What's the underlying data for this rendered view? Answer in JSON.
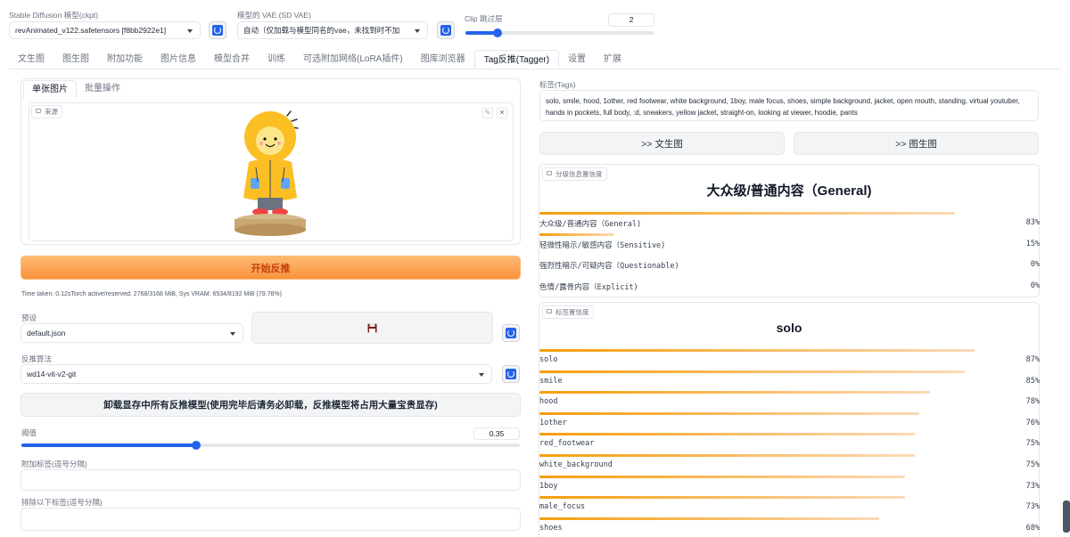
{
  "header": {
    "model_label": "Stable Diffusion 模型(ckpt)",
    "model_value": "revAnimated_v122.safetensors [f8bb2922e1]",
    "vae_label": "模型的 VAE (SD VAE)",
    "vae_value": "自动（仅加载与模型同名的vae，未找到时不加",
    "clip_label": "Clip 跳过层",
    "clip_value": "2",
    "clip_fraction": 0.17
  },
  "tabs": [
    "文生图",
    "图生图",
    "附加功能",
    "图片信息",
    "模型合并",
    "训练",
    "可选附加网络(LoRA插件)",
    "图库浏览器",
    "Tag反推(Tagger)",
    "设置",
    "扩展"
  ],
  "active_tab": "Tag反推(Tagger)",
  "left": {
    "subtabs": [
      "单张图片",
      "批量操作"
    ],
    "source_label": "来源",
    "interrogate_button": "开始反推",
    "time_info": "Time taken: 0.12sTorch active/reserved: 2768/3168 MiB, Sys VRAM: 6534/8192 MiB (79.76%)",
    "preset_label": "预设",
    "preset_value": "default.json",
    "save_icon": "floppy-disk-icon",
    "interrogator_label": "反推算法",
    "interrogator_value": "wd14-vit-v2-git",
    "unload_button": "卸载显存中所有反推模型(使用完毕后请务必卸载，反推模型将占用大量宝贵显存)",
    "threshold_label": "阈值",
    "threshold_value": "0.35",
    "threshold_fraction": 0.35,
    "additional_tags_label": "附加标签(逗号分隔)",
    "exclude_tags_label": "排除以下标签(逗号分隔)"
  },
  "right": {
    "tags_label": "标签(Tags)",
    "tags_text": "solo, smile, hood, 1other, red footwear, white background, 1boy, male focus, shoes, simple background, jacket, open mouth, standing, virtual youtuber, hands in pockets, full body, :d, sneakers, yellow jacket, straight-on, looking at viewer, hoodie, pants",
    "to_txt2img": ">> 文生图",
    "to_img2img": ">> 图生图",
    "rating_tag": "分级信息置信度",
    "rating_title": "大众级/普通内容（General)",
    "ratings": [
      {
        "label": "大众级/普通内容（General)",
        "pct": "83%",
        "value": 0.83
      },
      {
        "label": "轻微性暗示/敏感内容（Sensitive)",
        "pct": "15%",
        "value": 0.15
      },
      {
        "label": "强烈性暗示/可疑内容（Questionable)",
        "pct": "0%",
        "value": 0.0
      },
      {
        "label": "色情/露骨内容（Explicit)",
        "pct": "0%",
        "value": 0.0
      }
    ],
    "tag_conf_tag": "标签置信度",
    "tag_conf_title": "solo",
    "tag_confidences": [
      {
        "label": "solo",
        "pct": "87%",
        "value": 0.87
      },
      {
        "label": "smile",
        "pct": "85%",
        "value": 0.85
      },
      {
        "label": "hood",
        "pct": "78%",
        "value": 0.78
      },
      {
        "label": "1other",
        "pct": "76%",
        "value": 0.76
      },
      {
        "label": "red_footwear",
        "pct": "75%",
        "value": 0.75
      },
      {
        "label": "white_background",
        "pct": "75%",
        "value": 0.75
      },
      {
        "label": "1boy",
        "pct": "73%",
        "value": 0.73
      },
      {
        "label": "male_focus",
        "pct": "73%",
        "value": 0.73
      },
      {
        "label": "shoes",
        "pct": "68%",
        "value": 0.68
      }
    ]
  }
}
